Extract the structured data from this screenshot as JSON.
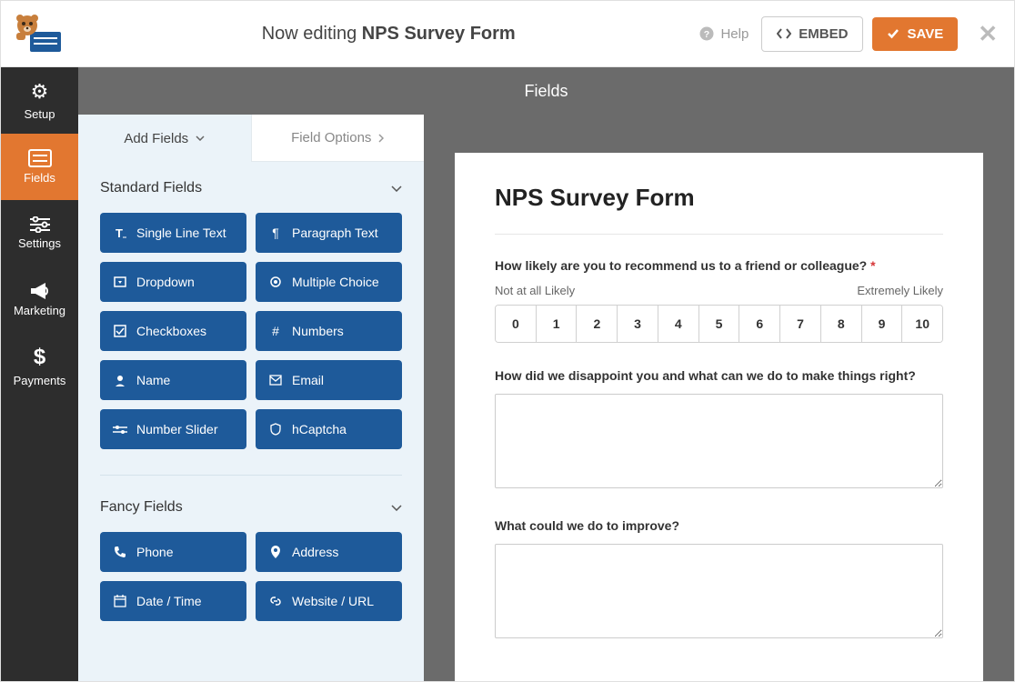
{
  "header": {
    "editing_prefix": "Now editing ",
    "form_name": "NPS Survey Form",
    "help_label": "Help",
    "embed_label": "EMBED",
    "save_label": "SAVE"
  },
  "sidebar": {
    "items": [
      {
        "label": "Setup",
        "icon": "gear"
      },
      {
        "label": "Fields",
        "icon": "form",
        "active": true
      },
      {
        "label": "Settings",
        "icon": "sliders"
      },
      {
        "label": "Marketing",
        "icon": "bullhorn"
      },
      {
        "label": "Payments",
        "icon": "dollar"
      }
    ]
  },
  "section_title": "Fields",
  "tabs": {
    "add_fields": "Add Fields",
    "field_options": "Field Options"
  },
  "groups": {
    "standard": {
      "title": "Standard Fields",
      "fields": [
        "Single Line Text",
        "Paragraph Text",
        "Dropdown",
        "Multiple Choice",
        "Checkboxes",
        "Numbers",
        "Name",
        "Email",
        "Number Slider",
        "hCaptcha"
      ]
    },
    "fancy": {
      "title": "Fancy Fields",
      "fields": [
        "Phone",
        "Address",
        "Date / Time",
        "Website / URL"
      ]
    }
  },
  "preview": {
    "title": "NPS Survey Form",
    "q1": "How likely are you to recommend us to a friend or colleague?",
    "scale_low": "Not at all Likely",
    "scale_high": "Extremely Likely",
    "scale": [
      "0",
      "1",
      "2",
      "3",
      "4",
      "5",
      "6",
      "7",
      "8",
      "9",
      "10"
    ],
    "q2": "How did we disappoint you and what can we do to make things right?",
    "q3": "What could we do to improve?"
  },
  "colors": {
    "accent": "#e27730",
    "field_button": "#1e5a9a"
  }
}
